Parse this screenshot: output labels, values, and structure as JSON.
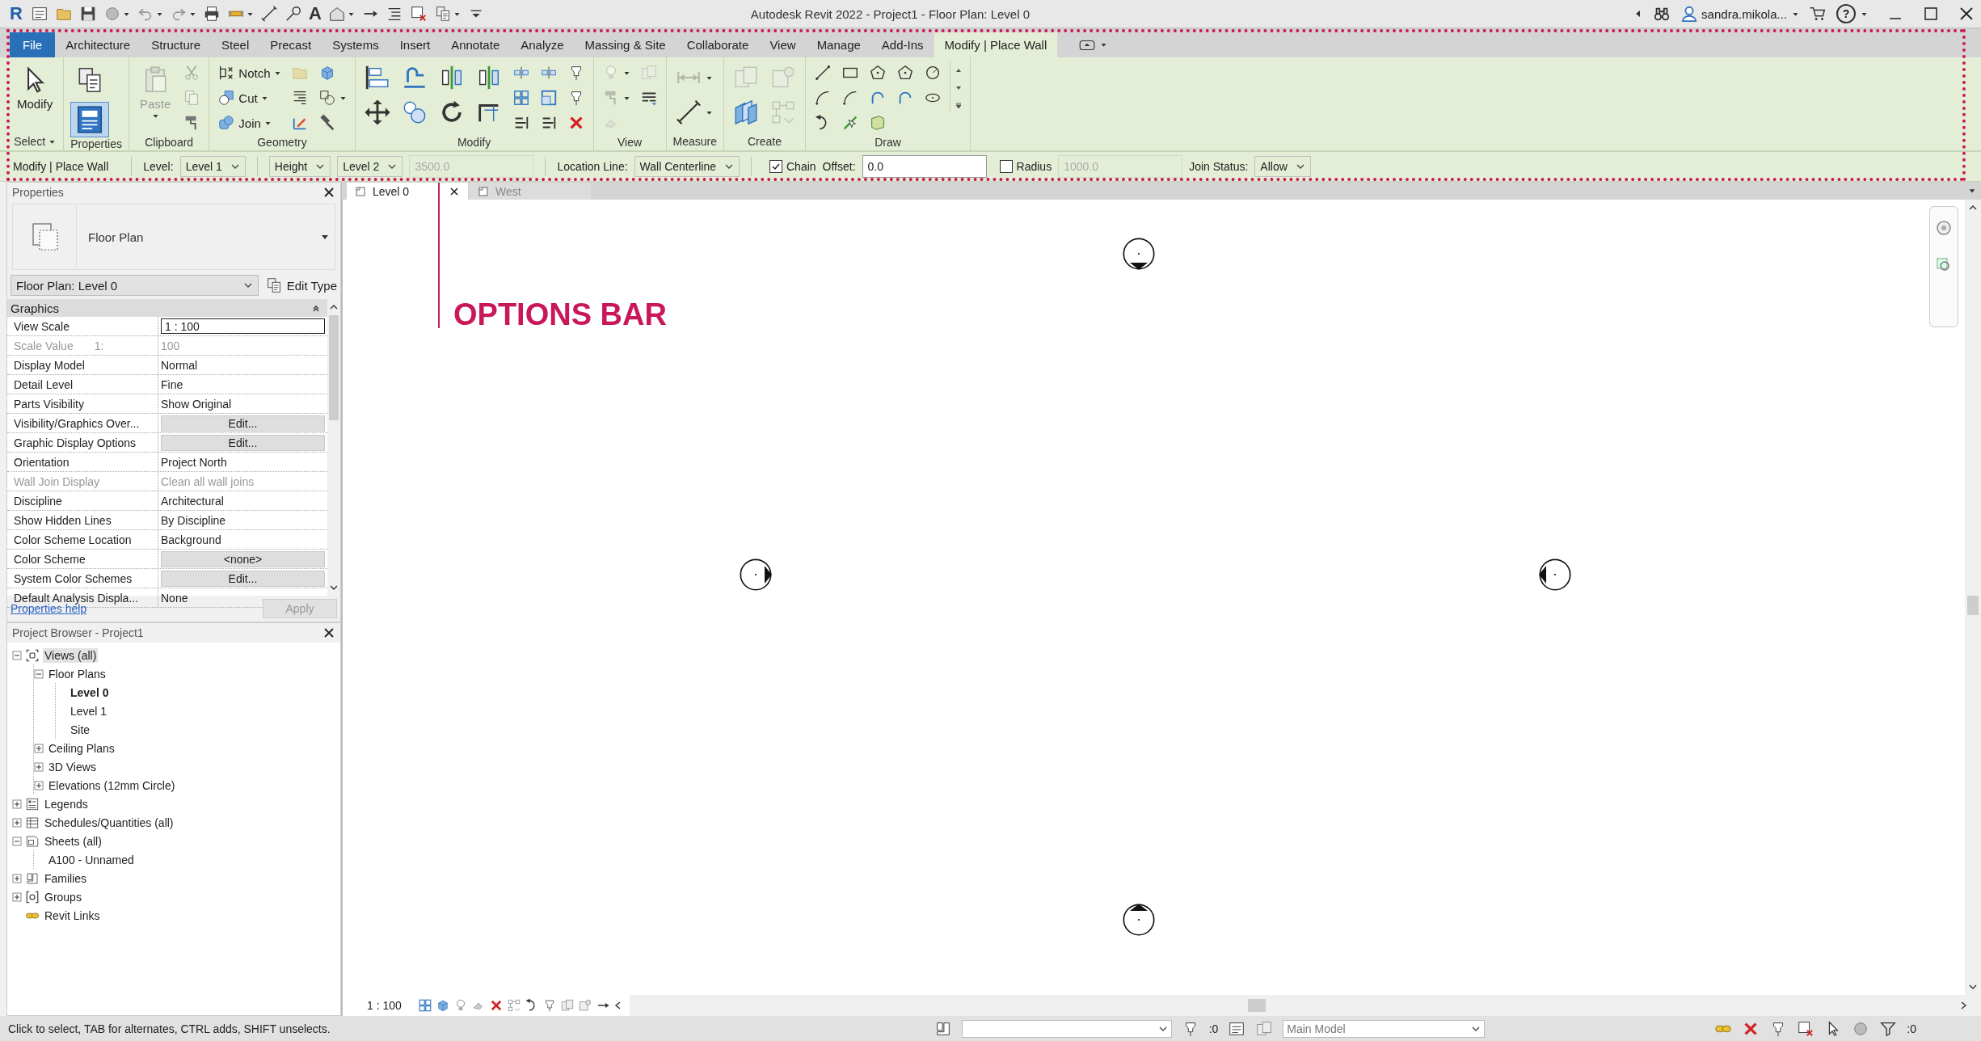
{
  "title_bar": {
    "logo": "R",
    "quick_access": [
      {
        "kind": "document",
        "menu": false
      },
      {
        "kind": "folder",
        "menu": false
      },
      {
        "kind": "save",
        "menu": false
      },
      {
        "kind": "globe",
        "menu": true
      },
      {
        "kind": "undo",
        "menu": true
      },
      {
        "kind": "redo",
        "menu": true
      },
      {
        "kind": "printer",
        "menu": false
      },
      {
        "kind": "tape",
        "menu": true
      },
      {
        "kind": "measure",
        "menu": false
      },
      {
        "kind": "tag",
        "menu": false
      },
      {
        "kind": "text",
        "label": "A",
        "menu": false
      },
      {
        "kind": "house",
        "menu": true
      },
      {
        "kind": "section",
        "menu": false
      },
      {
        "kind": "thinlines",
        "menu": false
      },
      {
        "kind": "closewin",
        "menu": false
      },
      {
        "kind": "windows",
        "menu": true
      },
      {
        "kind": "customize",
        "menu": false
      }
    ],
    "title": "Autodesk Revit 2022 - Project1 - Floor Plan: Level 0",
    "user": "sandra.mikola...",
    "help": "?"
  },
  "tabs": [
    {
      "label": "File",
      "kind": "file",
      "selected": false
    },
    {
      "label": "Architecture",
      "kind": "tab",
      "selected": false
    },
    {
      "label": "Structure",
      "kind": "tab",
      "selected": false
    },
    {
      "label": "Steel",
      "kind": "tab",
      "selected": false
    },
    {
      "label": "Precast",
      "kind": "tab",
      "selected": false
    },
    {
      "label": "Systems",
      "kind": "tab",
      "selected": false
    },
    {
      "label": "Insert",
      "kind": "tab",
      "selected": false
    },
    {
      "label": "Annotate",
      "kind": "tab",
      "selected": false
    },
    {
      "label": "Analyze",
      "kind": "tab",
      "selected": false
    },
    {
      "label": "Massing & Site",
      "kind": "tab",
      "selected": false
    },
    {
      "label": "Collaborate",
      "kind": "tab",
      "selected": false
    },
    {
      "label": "View",
      "kind": "tab",
      "selected": false
    },
    {
      "label": "Manage",
      "kind": "tab",
      "selected": false
    },
    {
      "label": "Add-Ins",
      "kind": "tab",
      "selected": false
    },
    {
      "label": "Modify | Place Wall",
      "kind": "tab",
      "selected": true
    }
  ],
  "ribbon": [
    {
      "label": "Select",
      "menu": true,
      "columns": [
        {
          "kind": "large",
          "tools": [
            {
              "kind": "cursor",
              "label": "Modify",
              "disabled": false,
              "pressed": false,
              "menu": false
            }
          ]
        }
      ]
    },
    {
      "label": "Properties",
      "menu": false,
      "columns": [
        {
          "kind": "large",
          "tools": [
            {
              "kind": "windows",
              "disabled": false,
              "pressed": false,
              "menu": false
            },
            {
              "kind": "properties",
              "disabled": false,
              "pressed": true,
              "menu": false
            }
          ]
        }
      ]
    },
    {
      "label": "Clipboard",
      "menu": false,
      "columns": [
        {
          "kind": "large",
          "tools": [
            {
              "kind": "clipboard",
              "label": "Paste",
              "disabled": true,
              "pressed": false,
              "menu": true
            }
          ]
        },
        {
          "kind": "small",
          "tools": [
            {
              "kind": "scissors",
              "disabled": true,
              "pressed": false,
              "menu": false
            },
            {
              "kind": "copy",
              "disabled": true,
              "pressed": false,
              "menu": false
            },
            {
              "kind": "brush",
              "disabled": false,
              "pressed": false,
              "menu": false
            }
          ]
        }
      ]
    },
    {
      "label": "Geometry",
      "menu": false,
      "columns": [
        {
          "kind": "small",
          "tools": [
            {
              "kind": "notch",
              "label": "Notch",
              "disabled": false,
              "pressed": false,
              "menu": true
            },
            {
              "kind": "cutshape",
              "label": "Cut",
              "disabled": false,
              "pressed": false,
              "menu": true
            },
            {
              "kind": "join",
              "label": "Join",
              "disabled": false,
              "pressed": false,
              "menu": true
            }
          ]
        },
        {
          "kind": "small",
          "tools": [
            {
              "kind": "folder",
              "disabled": true,
              "pressed": false,
              "menu": false
            },
            {
              "kind": "joints",
              "disabled": false,
              "pressed": false,
              "menu": false
            },
            {
              "kind": "paint",
              "disabled": false,
              "pressed": false,
              "menu": false
            }
          ]
        },
        {
          "kind": "small",
          "tools": [
            {
              "kind": "cube",
              "disabled": false,
              "pressed": false,
              "menu": false
            },
            {
              "kind": "splitface",
              "disabled": false,
              "pressed": false,
              "menu": true
            },
            {
              "kind": "hammer",
              "disabled": false,
              "pressed": false,
              "menu": false
            }
          ]
        }
      ]
    },
    {
      "label": "Modify",
      "menu": false,
      "columns": [
        {
          "kind": "medium",
          "tools": [
            {
              "kind": "align",
              "disabled": false,
              "pressed": false,
              "menu": false
            },
            {
              "kind": "move",
              "disabled": false,
              "pressed": false,
              "menu": false
            }
          ]
        },
        {
          "kind": "medium",
          "tools": [
            {
              "kind": "offset",
              "disabled": false,
              "pressed": false,
              "menu": false
            },
            {
              "kind": "circles",
              "disabled": false,
              "pressed": false,
              "menu": false
            }
          ]
        },
        {
          "kind": "medium",
          "tools": [
            {
              "kind": "mirror",
              "disabled": false,
              "pressed": false,
              "menu": false
            },
            {
              "kind": "rotate",
              "disabled": false,
              "pressed": false,
              "menu": false
            }
          ]
        },
        {
          "kind": "medium",
          "tools": [
            {
              "kind": "mirror",
              "disabled": false,
              "pressed": false,
              "menu": false
            },
            {
              "kind": "trim",
              "disabled": false,
              "pressed": false,
              "menu": false
            }
          ]
        },
        {
          "kind": "small",
          "tools": [
            {
              "kind": "split",
              "disabled": false,
              "pressed": false,
              "menu": false
            },
            {
              "kind": "grid",
              "disabled": false,
              "pressed": false,
              "menu": false
            },
            {
              "kind": "extend",
              "disabled": false,
              "pressed": false,
              "menu": false
            }
          ]
        },
        {
          "kind": "small",
          "tools": [
            {
              "kind": "split",
              "disabled": false,
              "pressed": false,
              "menu": false
            },
            {
              "kind": "scale",
              "disabled": false,
              "pressed": false,
              "menu": false
            },
            {
              "kind": "extend",
              "disabled": false,
              "pressed": false,
              "menu": false
            }
          ]
        },
        {
          "kind": "small",
          "tools": [
            {
              "kind": "pin",
              "disabled": false,
              "pressed": false,
              "menu": false
            },
            {
              "kind": "pin",
              "disabled": false,
              "pressed": false,
              "menu": false
            },
            {
              "kind": "delete",
              "disabled": false,
              "pressed": false,
              "menu": false
            }
          ]
        }
      ]
    },
    {
      "label": "View",
      "menu": false,
      "columns": [
        {
          "kind": "small",
          "tools": [
            {
              "kind": "bulb",
              "disabled": true,
              "pressed": false,
              "menu": true
            },
            {
              "kind": "brush",
              "disabled": true,
              "pressed": false,
              "menu": true
            },
            {
              "kind": "eraser",
              "disabled": true,
              "pressed": false,
              "menu": false
            }
          ]
        },
        {
          "kind": "small",
          "tools": [
            {
              "kind": "boxes",
              "disabled": true,
              "pressed": false,
              "menu": false
            },
            {
              "kind": "linestyle",
              "disabled": false,
              "pressed": false,
              "menu": false
            }
          ]
        }
      ]
    },
    {
      "label": "Measure",
      "menu": false,
      "columns": [
        {
          "kind": "medium",
          "tools": [
            {
              "kind": "dimension",
              "disabled": true,
              "pressed": false,
              "menu": true
            },
            {
              "kind": "measure",
              "disabled": false,
              "pressed": false,
              "menu": true
            }
          ]
        }
      ]
    },
    {
      "label": "Create",
      "menu": false,
      "columns": [
        {
          "kind": "medium",
          "tools": [
            {
              "kind": "boxes",
              "disabled": true,
              "pressed": false,
              "menu": false
            },
            {
              "kind": "panels",
              "disabled": false,
              "pressed": false,
              "menu": false
            }
          ]
        },
        {
          "kind": "medium",
          "tools": [
            {
              "kind": "gearbox",
              "disabled": true,
              "pressed": false,
              "menu": false
            },
            {
              "kind": "linked",
              "disabled": true,
              "pressed": false,
              "menu": false
            }
          ]
        }
      ]
    },
    {
      "label": "Draw",
      "menu": false,
      "columns": [
        {
          "kind": "small",
          "tools": [
            {
              "kind": "line",
              "disabled": false,
              "pressed": false,
              "menu": false
            },
            {
              "kind": "arc",
              "disabled": false,
              "pressed": false,
              "menu": false
            },
            {
              "kind": "curvearrow",
              "disabled": false,
              "pressed": false,
              "menu": false
            }
          ]
        },
        {
          "kind": "small",
          "tools": [
            {
              "kind": "rect",
              "disabled": false,
              "pressed": false,
              "menu": false
            },
            {
              "kind": "arc",
              "disabled": false,
              "pressed": false,
              "menu": false
            },
            {
              "kind": "pickline",
              "disabled": false,
              "pressed": false,
              "menu": false
            }
          ]
        },
        {
          "kind": "small",
          "tools": [
            {
              "kind": "pentagon",
              "disabled": false,
              "pressed": false,
              "menu": false
            },
            {
              "kind": "bluearc",
              "disabled": false,
              "pressed": false,
              "menu": false
            },
            {
              "kind": "face",
              "disabled": false,
              "pressed": false,
              "menu": false
            }
          ]
        },
        {
          "kind": "small",
          "tools": [
            {
              "kind": "pentagon",
              "disabled": false,
              "pressed": false,
              "menu": false
            },
            {
              "kind": "bluearc",
              "disabled": false,
              "pressed": false,
              "menu": false
            }
          ]
        },
        {
          "kind": "small",
          "tools": [
            {
              "kind": "circle",
              "disabled": false,
              "pressed": false,
              "menu": false
            },
            {
              "kind": "ellipse",
              "disabled": false,
              "pressed": false,
              "menu": false
            }
          ]
        },
        {
          "kind": "scroll"
        }
      ]
    }
  ],
  "options_bar": [
    {
      "kind": "text",
      "text": "Modify | Place Wall"
    },
    {
      "kind": "separator"
    },
    {
      "kind": "label",
      "text": "Level:"
    },
    {
      "kind": "dropdown",
      "text": "Level 1"
    },
    {
      "kind": "separator"
    },
    {
      "kind": "dropdown",
      "text": "Height"
    },
    {
      "kind": "dropdown",
      "text": "Level 2"
    },
    {
      "kind": "field",
      "text": "3500.0",
      "disabled": true
    },
    {
      "kind": "separator"
    },
    {
      "kind": "label",
      "text": "Location Line:"
    },
    {
      "kind": "dropdown",
      "text": "Wall Centerline"
    },
    {
      "kind": "separator"
    },
    {
      "kind": "checkbox",
      "text": "Chain",
      "checked": true
    },
    {
      "kind": "label",
      "text": "Offset:"
    },
    {
      "kind": "field",
      "text": "0.0",
      "disabled": false
    },
    {
      "kind": "checkbox",
      "text": "Radius",
      "checked": false
    },
    {
      "kind": "field",
      "text": "1000.0",
      "disabled": true
    },
    {
      "kind": "label",
      "text": "Join Status:"
    },
    {
      "kind": "dropdown",
      "text": "Allow"
    }
  ],
  "annotation": {
    "label": "OPTIONS BAR"
  },
  "properties": {
    "title": "Properties",
    "type": "Floor Plan",
    "selector": "Floor Plan: Level 0",
    "edit_type": "Edit Type",
    "group": "Graphics",
    "rows": [
      {
        "name": "View Scale",
        "value": "1 : 100",
        "kind": "input",
        "disabled": false
      },
      {
        "name": "Scale Value",
        "suffix": "1:",
        "value": "100",
        "kind": "text",
        "disabled": true
      },
      {
        "name": "Display Model",
        "value": "Normal",
        "kind": "text",
        "disabled": false
      },
      {
        "name": "Detail Level",
        "value": "Fine",
        "kind": "text",
        "disabled": false
      },
      {
        "name": "Parts Visibility",
        "value": "Show Original",
        "kind": "text",
        "disabled": false
      },
      {
        "name": "Visibility/Graphics Over...",
        "value": "Edit...",
        "kind": "button",
        "disabled": false
      },
      {
        "name": "Graphic Display Options",
        "value": "Edit...",
        "kind": "button",
        "disabled": false
      },
      {
        "name": "Orientation",
        "value": "Project North",
        "kind": "text",
        "disabled": false
      },
      {
        "name": "Wall Join Display",
        "value": "Clean all wall joins",
        "kind": "text",
        "disabled": true
      },
      {
        "name": "Discipline",
        "value": "Architectural",
        "kind": "text",
        "disabled": false
      },
      {
        "name": "Show Hidden Lines",
        "value": "By Discipline",
        "kind": "text",
        "disabled": false
      },
      {
        "name": "Color Scheme Location",
        "value": "Background",
        "kind": "text",
        "disabled": false
      },
      {
        "name": "Color Scheme",
        "value": "<none>",
        "kind": "button",
        "disabled": false
      },
      {
        "name": "System Color Schemes",
        "value": "Edit...",
        "kind": "button",
        "disabled": false
      },
      {
        "name": "Default Analysis Displa...",
        "value": "None",
        "kind": "text",
        "disabled": false
      }
    ],
    "help": "Properties help",
    "apply": {
      "label": "Apply",
      "disabled": true
    }
  },
  "project_browser": {
    "title": "Project Browser - Project1",
    "tree": [
      {
        "label": "Views (all)",
        "kind": "views",
        "expanded": true,
        "selected": true,
        "current": false,
        "children": [
          {
            "label": "Floor Plans",
            "expanded": true,
            "selected": false,
            "current": false,
            "children": [
              {
                "label": "Level 0",
                "selected": false,
                "current": true
              },
              {
                "label": "Level 1",
                "selected": false,
                "current": false
              },
              {
                "label": "Site",
                "selected": false,
                "current": false
              }
            ]
          },
          {
            "label": "Ceiling Plans",
            "expanded": false,
            "selected": false,
            "current": false
          },
          {
            "label": "3D Views",
            "expanded": false,
            "selected": false,
            "current": false
          },
          {
            "label": "Elevations (12mm Circle)",
            "expanded": false,
            "selected": false,
            "current": false
          }
        ]
      },
      {
        "label": "Legends",
        "kind": "legends",
        "expanded": false,
        "selected": false,
        "current": false
      },
      {
        "label": "Schedules/Quantities (all)",
        "kind": "schedules",
        "expanded": false,
        "selected": false,
        "current": false
      },
      {
        "label": "Sheets (all)",
        "kind": "sheets",
        "expanded": true,
        "selected": false,
        "current": false,
        "children": [
          {
            "label": "A100 - Unnamed",
            "selected": false,
            "current": false
          }
        ]
      },
      {
        "label": "Families",
        "kind": "families",
        "expanded": false,
        "selected": false,
        "current": false
      },
      {
        "label": "Groups",
        "kind": "groups",
        "expanded": false,
        "selected": false,
        "current": false
      },
      {
        "label": "Revit Links",
        "kind": "links",
        "selected": false,
        "current": false
      }
    ]
  },
  "view_tabs": [
    {
      "label": "Level 0",
      "selected": true
    },
    {
      "label": "West",
      "selected": false
    }
  ],
  "view_control_bar": {
    "scale": "1 : 100"
  },
  "status_bar": {
    "message": "Click to select, TAB for alternates, CTRL adds, SHIFT unselects.",
    "editable_count": ":0",
    "design_option": "Main Model",
    "filter_count": ":0"
  }
}
